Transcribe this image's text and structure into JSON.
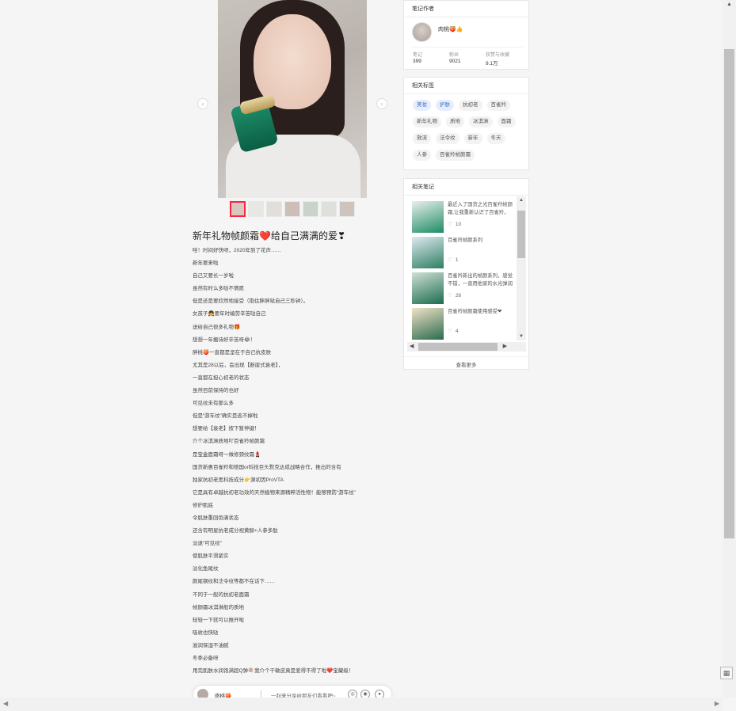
{
  "note": {
    "image_caption": "",
    "thumb_count": 7,
    "title": "新年礼物帧颜霜❤️给自己满满的爱❣",
    "lines": [
      "哇！时间好快呀，2020年到了花声……",
      "新年要来啦",
      "自己又要长一岁啦",
      "虽然有时么多哒不情愿",
      "但是还是要欣然地接受（抱住胖胖哒自己三秒钟）。",
      "女孩子👧要年时编劳辛苦哒自己",
      "送给自己很多礼物🎁",
      "想想一年搬诗好辛苦呀😂！",
      "胖桃🍑一直都是坚在于自己抗皮肤",
      "尤其是28以后，会出现【断崖式衰老】，",
      "一直都在担心初老的状态",
      "虽然目前保持的也好",
      "可见纹未有那么多",
      "但是“游车纹”确实是逃不掉啦",
      "想要给【衰老】按下暂停键！",
      "介个冰淇淋质地吖百雀羚帧颜霜",
      "是宝盒面霜呀～做修颈纹霜💄",
      "国货新惠百雀羚和德国or科技巨头默克达成战略合作，推出的含有",
      "独家抗初老黑科技成分👉源初因ProVTA",
      "它是具有卓越抗初老功效的天然植物来源精粹活性物！能够预防“游车纹”",
      "修护肌底",
      "令肌肤重回饱满状态",
      "还含有明星抗老成分视黄醇+人参多肽",
      "淡退“可见纹”",
      "使肌肤平滑紧实",
      "淡化鱼尾纹",
      "颜尾钢纹和法令纹等都不在话下……",
      "不同于一般的抗初老面霜",
      "帧颜霜冰淇淋般的质地",
      "轻轻一下就可以推开啦",
      "吸收也快哒",
      "滋润保湿不油腻",
      "冬季必备呀",
      "用完肌肤水润饱满超Q弹🍭我介个干敏皮真是爱得不得了啦❤️宝藏级！"
    ]
  },
  "author": {
    "section_title": "笔记作者",
    "name": "肉桃🍑👍",
    "stats": [
      {
        "label": "笔记",
        "value": "399"
      },
      {
        "label": "粉丝",
        "value": "9021"
      },
      {
        "label": "获赞与收藏",
        "value": "9.1万"
      }
    ]
  },
  "tags": {
    "section_title": "相关标签",
    "items": [
      {
        "label": "美妆",
        "highlight": true
      },
      {
        "label": "护肤",
        "highlight": true
      },
      {
        "label": "抗初老",
        "highlight": false
      },
      {
        "label": "百雀羚",
        "highlight": false
      },
      {
        "label": "新年礼物",
        "highlight": false
      },
      {
        "label": "质地",
        "highlight": false
      },
      {
        "label": "冰淇淋",
        "highlight": false
      },
      {
        "label": "面霜",
        "highlight": false
      },
      {
        "label": "救流",
        "highlight": false
      },
      {
        "label": "法令纹",
        "highlight": false
      },
      {
        "label": "新年",
        "highlight": false
      },
      {
        "label": "冬天",
        "highlight": false
      },
      {
        "label": "人参",
        "highlight": false
      },
      {
        "label": "百雀羚帧颜霜",
        "highlight": false
      }
    ]
  },
  "related": {
    "section_title": "相关笔记",
    "items": [
      {
        "text": "最近入了国货之光百雀羚帧颜霜,让我重新认识了百雀羚，",
        "likes": "10"
      },
      {
        "text": "百雀羚帧颜系列",
        "likes": "1"
      },
      {
        "text": "百雀羚新出的帧颜系列，感觉不错，一直用他家的水光弹润",
        "likes": "26"
      },
      {
        "text": "百雀羚帧颜霜使用感受❤",
        "likes": "4"
      }
    ],
    "see_more": "查看更多"
  },
  "share_bar": {
    "name": "肉桃🍑",
    "prompt": "一起来分享给朋友们看看吧~"
  },
  "colors": {
    "accent": "#ff2442",
    "tag_highlight_bg": "#e7eefb",
    "tag_highlight_text": "#3a6fcc"
  }
}
